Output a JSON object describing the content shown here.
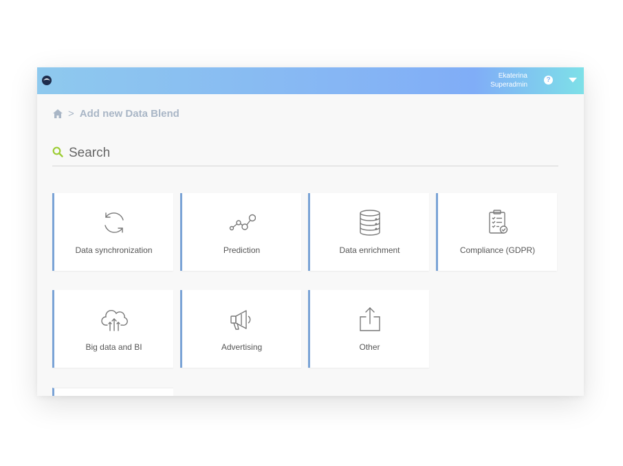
{
  "header": {
    "user_name": "Ekaterina",
    "user_role": "Superadmin",
    "help_glyph": "?",
    "icons": [
      "logo-icon",
      "help-icon",
      "caret-down-icon"
    ],
    "gradient_colors": [
      "#8ec9ee",
      "#86b6f4",
      "#7ee0e8"
    ]
  },
  "breadcrumb": {
    "separator": ">",
    "title": "Add new Data Blend",
    "home_icon": "home-icon"
  },
  "search": {
    "placeholder": "Search",
    "value": "",
    "icon": "search-icon",
    "icon_color": "#9ccc33"
  },
  "categories": [
    {
      "label": "Data synchronization",
      "icon": "sync-icon"
    },
    {
      "label": "Prediction",
      "icon": "prediction-icon"
    },
    {
      "label": "Data enrichment",
      "icon": "database-icon"
    },
    {
      "label": "Compliance (GDPR)",
      "icon": "clipboard-check-icon"
    },
    {
      "label": "Big data and BI",
      "icon": "cloud-upload-icon"
    },
    {
      "label": "Advertising",
      "icon": "megaphone-icon"
    },
    {
      "label": "Other",
      "icon": "share-icon"
    }
  ],
  "colors": {
    "card_accent": "#7aa3d6",
    "breadcrumb_text": "#a9b6c6",
    "card_label": "#555555"
  }
}
